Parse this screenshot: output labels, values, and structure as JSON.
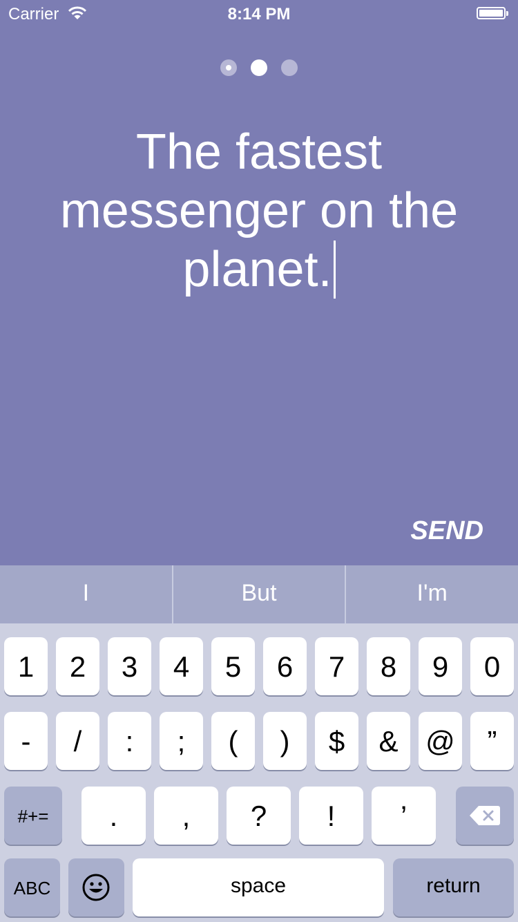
{
  "status_bar": {
    "carrier": "Carrier",
    "time": "8:14 PM"
  },
  "pager": {
    "count": 3,
    "active_index": 1
  },
  "headline": "The fastest messenger on the planet.",
  "send_label": "SEND",
  "suggestions": [
    "I",
    "But",
    "I'm"
  ],
  "keyboard": {
    "row1": [
      "1",
      "2",
      "3",
      "4",
      "5",
      "6",
      "7",
      "8",
      "9",
      "0"
    ],
    "row2": [
      "-",
      "/",
      ":",
      ";",
      "(",
      ")",
      "$",
      "&",
      "@",
      "”"
    ],
    "row3": [
      ".",
      ",",
      "?",
      "!",
      "’"
    ],
    "symbols_label": "#+=",
    "abc_label": "ABC",
    "space_label": "space",
    "return_label": "return"
  },
  "colors": {
    "background": "#7c7db3",
    "suggestion_bar": "#a3a8c8",
    "keyboard": "#cdd0e1",
    "dark_key": "#a9afcc"
  },
  "icons": {
    "wifi": "wifi-icon",
    "battery": "battery-icon",
    "backspace": "backspace-icon",
    "emoji": "emoji-icon"
  }
}
